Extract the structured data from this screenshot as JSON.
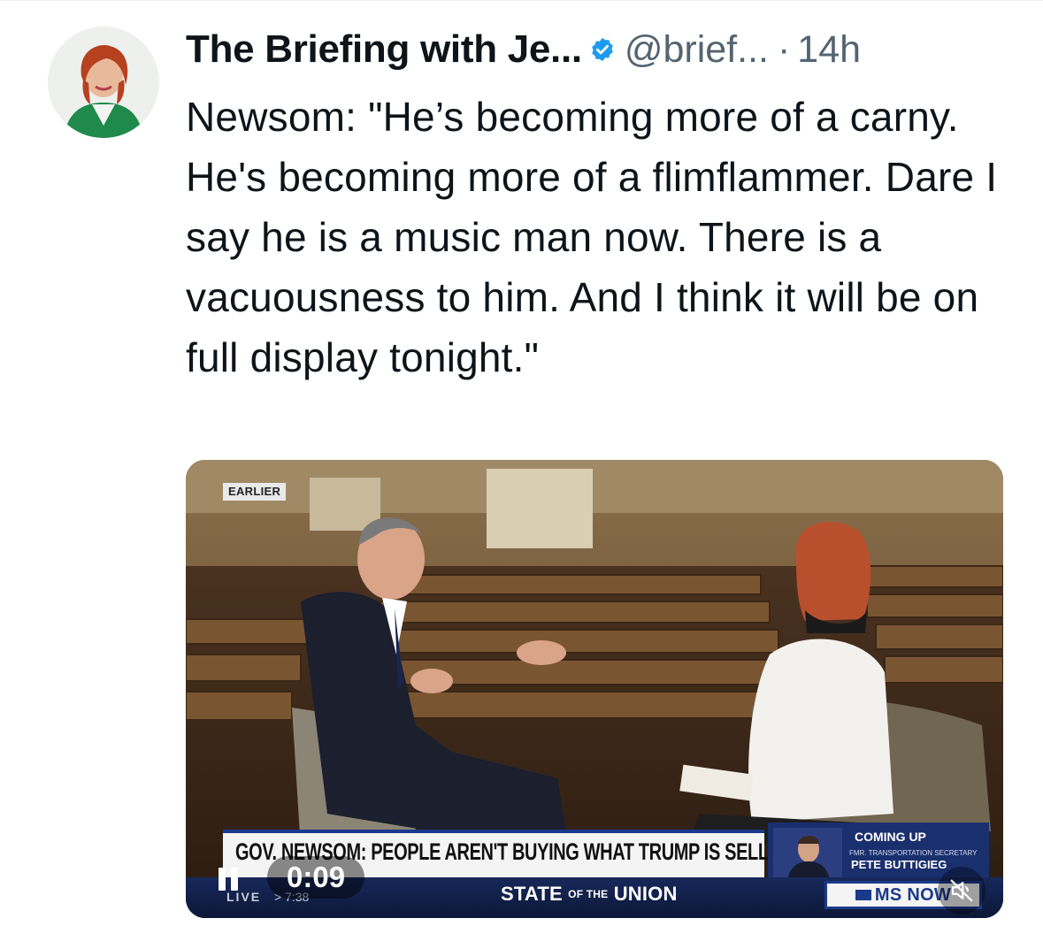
{
  "author": {
    "display_name": "The Briefing with Je...",
    "handle": "@brief...",
    "separator": "·",
    "time": "14h",
    "avatar_icon": "avatar-photo-icon",
    "verified_icon": "verified-badge-icon",
    "verified_color": "#1d9bf0"
  },
  "tweet": {
    "text": "Newsom: \"He’s becoming more of a carny. He's becoming more of a flimflammer. Dare I say he is a music man now. There is a vacuousness to him. And I think it will be on full display tonight.\""
  },
  "video": {
    "badge": "EARLIER",
    "headline": "GOV. NEWSOM: PEOPLE AREN'T BUYING WHAT TRUMP IS SELLING",
    "show_name_a": "STATE",
    "show_name_of": "OF THE",
    "show_name_b": "UNION",
    "live_label": "LIVE",
    "clock": "> 7:38",
    "coming_up": "COMING UP",
    "coming_sub": "FMR. TRANSPORTATION SECRETARY",
    "coming_name": "PETE BUTTIGIEG",
    "network": "MS NOW",
    "timecode": "0:09",
    "playing": true,
    "muted": true,
    "pause_icon": "pause-icon",
    "mute_icon": "speaker-muted-icon"
  }
}
